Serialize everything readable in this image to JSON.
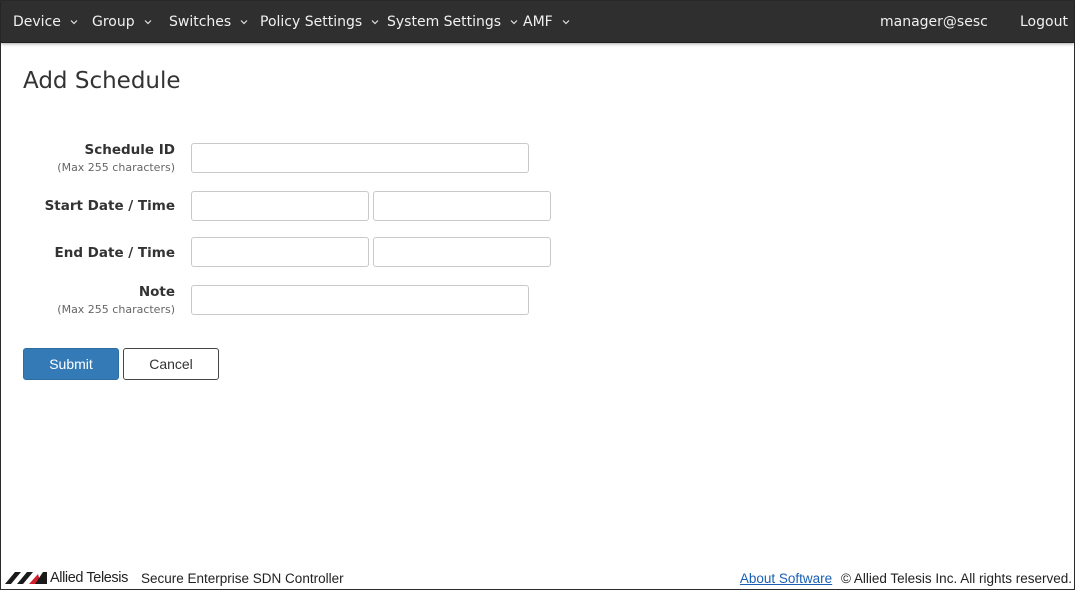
{
  "nav": {
    "items": [
      {
        "label": "Device"
      },
      {
        "label": "Group"
      },
      {
        "label": "Switches"
      },
      {
        "label": "Policy Settings"
      },
      {
        "label": "System Settings"
      },
      {
        "label": "AMF"
      }
    ],
    "user": "manager@sesc",
    "logout": "Logout"
  },
  "page": {
    "title": "Add Schedule"
  },
  "form": {
    "schedule_id": {
      "label": "Schedule ID",
      "hint": "(Max 255 characters)",
      "value": ""
    },
    "start": {
      "label": "Start Date / Time",
      "date_value": "",
      "time_value": ""
    },
    "end": {
      "label": "End Date / Time",
      "date_value": "",
      "time_value": ""
    },
    "note": {
      "label": "Note",
      "hint": "(Max 255 characters)",
      "value": ""
    },
    "submit_label": "Submit",
    "cancel_label": "Cancel"
  },
  "footer": {
    "brand": "Allied Telesis",
    "product": "Secure Enterprise SDN Controller",
    "about_link": "About Software",
    "copyright": "© Allied Telesis Inc. All rights reserved."
  },
  "colors": {
    "nav_bg": "#2f2f2f",
    "primary": "#337ab7",
    "link": "#1a5fb4"
  }
}
